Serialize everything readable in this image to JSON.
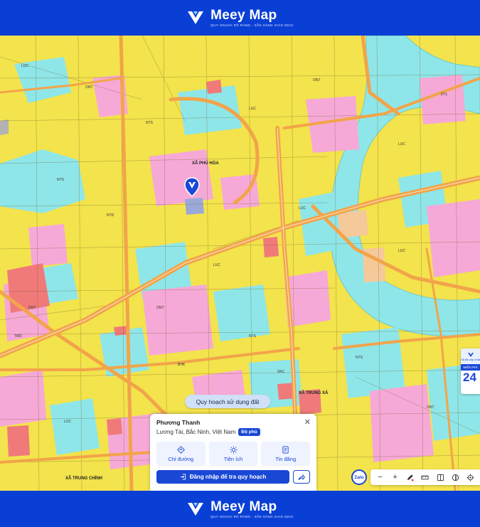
{
  "brand": {
    "name": "Meey Map",
    "tagline": "QUY HOẠCH RÕ RÀNG - SẴN SÀNG GIAO DỊCH"
  },
  "map": {
    "place_labels": [
      "XÃ PHÚ HÒA",
      "XÃ TRUNG CHÍNH",
      "XÃ TRUNG XÁ"
    ],
    "zone_codes": [
      "LUC",
      "ONT",
      "NTS",
      "DGT",
      "NTD",
      "SKC",
      "DTL",
      "TMD",
      "BHK"
    ]
  },
  "chip": {
    "label": "Quy hoạch sử dụng đất"
  },
  "card": {
    "title": "Phương Thanh",
    "location": "Lương Tài, Bắc Ninh, Việt Nam",
    "badge": "Độ phủ",
    "actions": [
      {
        "label": "Chỉ đường",
        "icon": "directions-icon"
      },
      {
        "label": "Tiện ích",
        "icon": "amenities-icon"
      },
      {
        "label": "Tin đăng",
        "icon": "listing-icon"
      }
    ],
    "login_label": "Đăng nhập để tra quy hoạch"
  },
  "toolbar": {
    "zalo": "Zalo",
    "zoom_out": "−",
    "zoom_in": "+"
  },
  "side_panel": {
    "label": "Xã đã cập nhật",
    "mid": "MIỄN PHÍ",
    "number": "24"
  },
  "colors": {
    "brand_blue": "#0a3fd6",
    "residential_yellow": "#f3e34c",
    "water_cyan": "#8fe6e8",
    "road_orange": "#f2a44a",
    "pink_zone": "#f6a9d6",
    "red_zone": "#f07a7a"
  }
}
